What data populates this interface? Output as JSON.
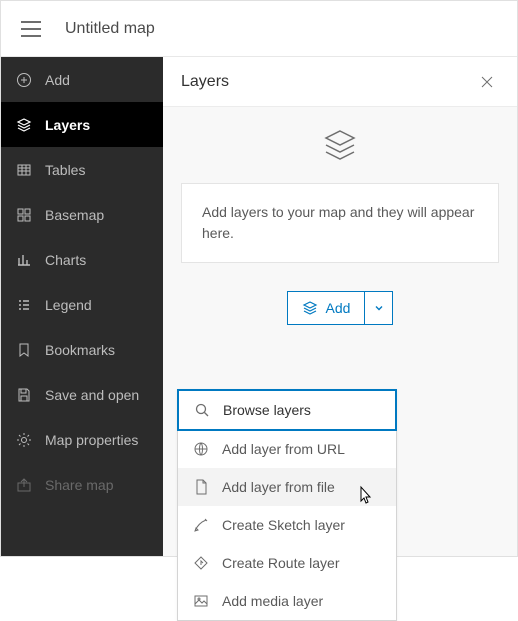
{
  "header": {
    "title": "Untitled map"
  },
  "sidebar": {
    "items": [
      {
        "id": "add",
        "label": "Add"
      },
      {
        "id": "layers",
        "label": "Layers"
      },
      {
        "id": "tables",
        "label": "Tables"
      },
      {
        "id": "basemap",
        "label": "Basemap"
      },
      {
        "id": "charts",
        "label": "Charts"
      },
      {
        "id": "legend",
        "label": "Legend"
      },
      {
        "id": "bookmarks",
        "label": "Bookmarks"
      },
      {
        "id": "save-and-open",
        "label": "Save and open"
      },
      {
        "id": "map-properties",
        "label": "Map properties"
      },
      {
        "id": "share-map",
        "label": "Share map"
      }
    ]
  },
  "panel": {
    "title": "Layers",
    "empty_message": "Add layers to your map and they will appear here.",
    "add_button": "Add"
  },
  "dropdown": {
    "items": [
      {
        "id": "browse",
        "label": "Browse layers"
      },
      {
        "id": "url",
        "label": "Add layer from URL"
      },
      {
        "id": "file",
        "label": "Add layer from file"
      },
      {
        "id": "sketch",
        "label": "Create Sketch layer"
      },
      {
        "id": "route",
        "label": "Create Route layer"
      },
      {
        "id": "media",
        "label": "Add media layer"
      }
    ]
  }
}
